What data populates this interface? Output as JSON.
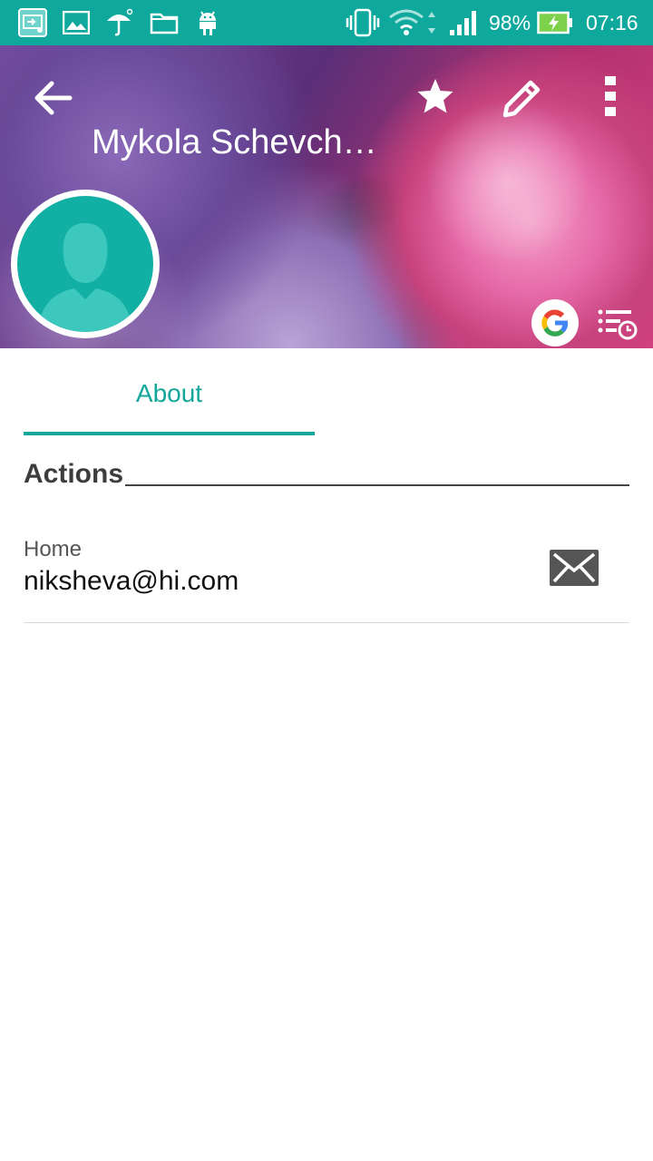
{
  "status_bar": {
    "battery": "98%",
    "time": "07:16",
    "icons": [
      "screen-mirror-icon",
      "gallery-icon",
      "umbrella-icon",
      "folder-icon",
      "android-icon",
      "vibrate-icon",
      "wifi-icon",
      "signal-icon",
      "battery-charging-icon"
    ],
    "colors": {
      "background": "#0fa89c"
    }
  },
  "header": {
    "title": "Mykola Schevch…",
    "icons": [
      "back-arrow-icon",
      "star-icon",
      "edit-pencil-icon",
      "more-vert-icon",
      "google-icon",
      "history-list-icon",
      "contact-avatar-icon"
    ]
  },
  "tabs": [
    {
      "label": "About",
      "selected": true
    }
  ],
  "sections": {
    "actions_title": "Actions"
  },
  "contact_rows": [
    {
      "type": "Home",
      "value": "niksheva@hi.com",
      "icon": "email-icon"
    }
  ],
  "colors": {
    "accent": "#13a79b",
    "text_primary": "#111111",
    "text_secondary": "#555555"
  }
}
